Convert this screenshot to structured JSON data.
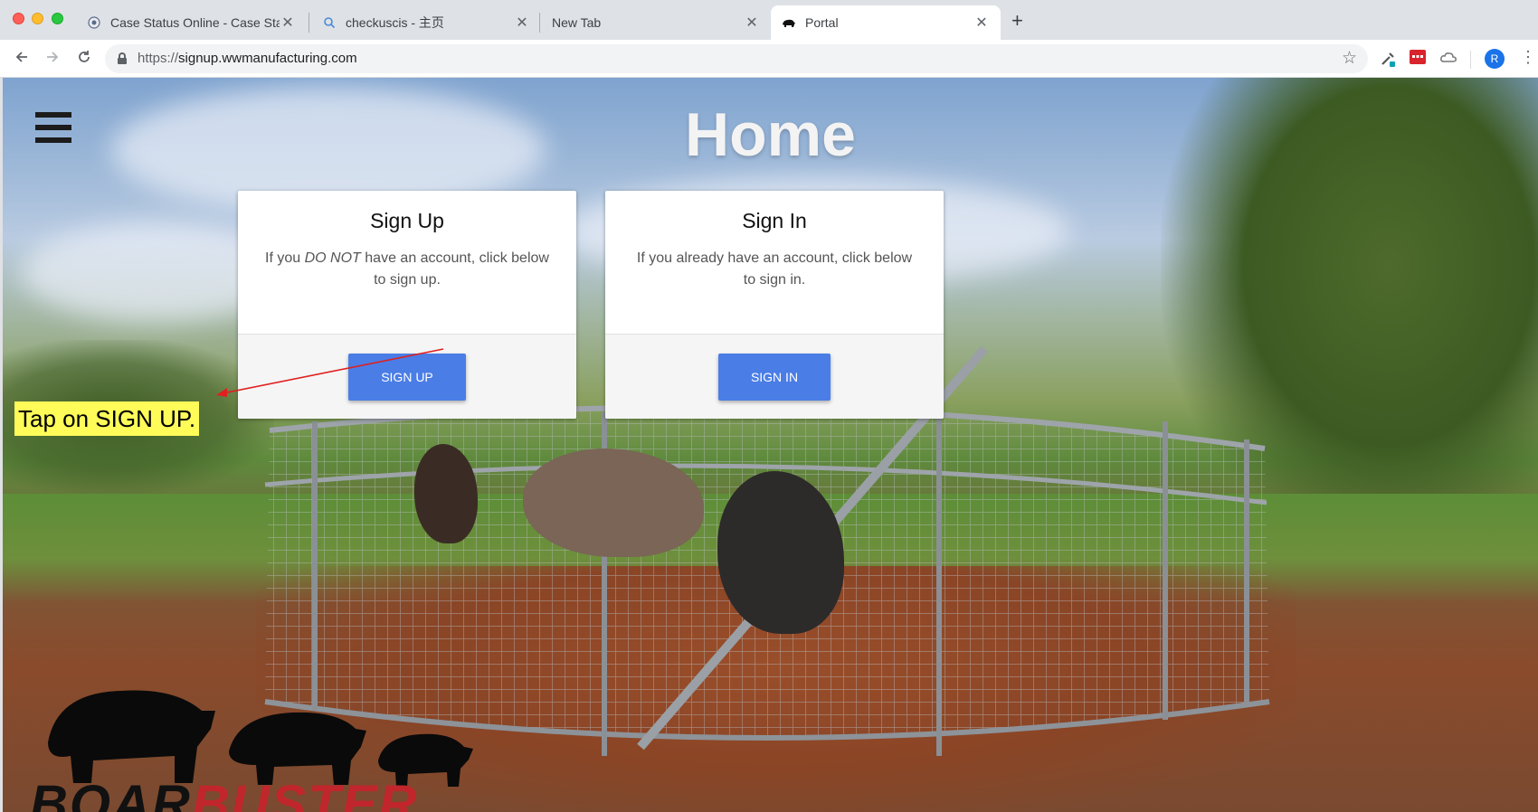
{
  "browser": {
    "tabs": [
      {
        "title": "Case Status Online - Case Stat",
        "icon": "uscis-seal-icon",
        "active": false
      },
      {
        "title": "checkuscis - 主页",
        "icon": "search-icon",
        "active": false
      },
      {
        "title": "New Tab",
        "icon": "",
        "active": false
      },
      {
        "title": "Portal",
        "icon": "boar-favicon-icon",
        "active": true
      }
    ],
    "new_tab_glyph": "+",
    "close_glyph": "✕",
    "url_scheme": "https://",
    "url_host": "signup.wwmanufacturing.com",
    "profile_initial": "R"
  },
  "page": {
    "title": "Home",
    "signup_card": {
      "heading": "Sign Up",
      "text_before": "If you ",
      "text_emphasis": "DO NOT",
      "text_after": " have an account, click below to sign up.",
      "button": "SIGN UP"
    },
    "signin_card": {
      "heading": "Sign In",
      "text": "If you already have an account, click below to sign in.",
      "button": "SIGN IN"
    },
    "logo_part1": "BOAR",
    "logo_part2": "BUSTER"
  },
  "annotation": {
    "text": "Tap on SIGN UP.",
    "highlight_color": "#fffc5a",
    "arrow_color": "#e02020"
  },
  "colors": {
    "button": "#4a7de6",
    "logo_red": "#c0262b"
  }
}
